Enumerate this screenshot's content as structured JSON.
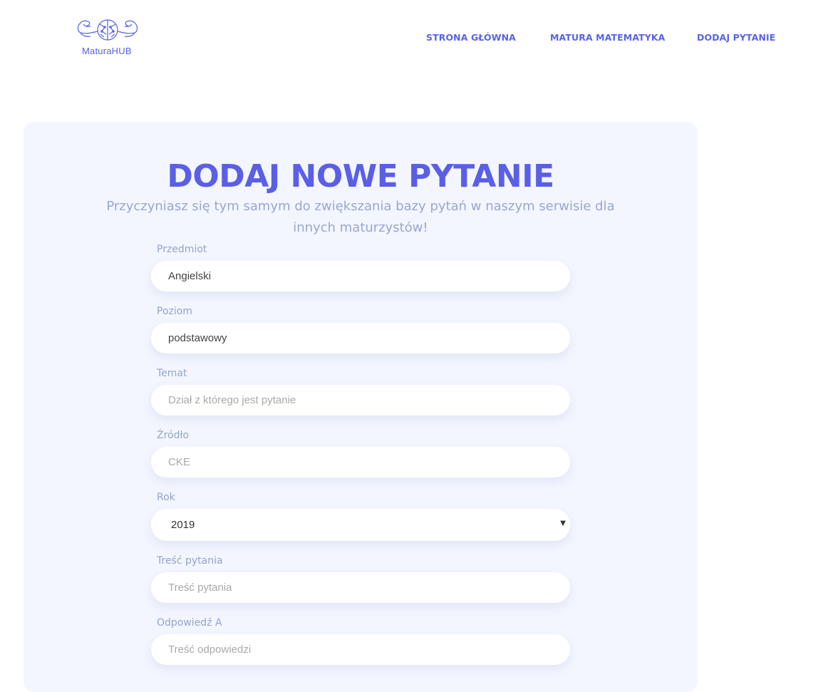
{
  "header": {
    "logo_text": "MaturaHUB",
    "nav": [
      {
        "label": "STRONA GŁÓWNA"
      },
      {
        "label": "MATURA MATEMATYKA"
      },
      {
        "label": "DODAJ PYTANIE"
      }
    ]
  },
  "form": {
    "title": "DODAJ NOWE PYTANIE",
    "subtitle": "Przyczyniasz się tym samym do zwiększania bazy pytań w naszym serwisie dla innych maturzystów!",
    "fields": {
      "subject": {
        "label": "Przedmiot",
        "value": "Angielski"
      },
      "level": {
        "label": "Poziom",
        "value": "podstawowy"
      },
      "topic": {
        "label": "Temat",
        "placeholder": "Dział z którego jest pytanie"
      },
      "source": {
        "label": "Źródło",
        "placeholder": "CKE"
      },
      "year": {
        "label": "Rok",
        "value": "2019"
      },
      "question": {
        "label": "Treść pytania",
        "placeholder": "Treść pytania"
      },
      "answer_a": {
        "label": "Odpowiedź A",
        "placeholder": "Treść odpowiedzi"
      }
    }
  },
  "colors": {
    "accent": "#5a5fe6",
    "card_bg": "#f3f6ff",
    "label": "#94a3c7"
  },
  "icons": {
    "logo": "brain-with-flexed-arms-icon",
    "select": "caret-down-icon"
  }
}
